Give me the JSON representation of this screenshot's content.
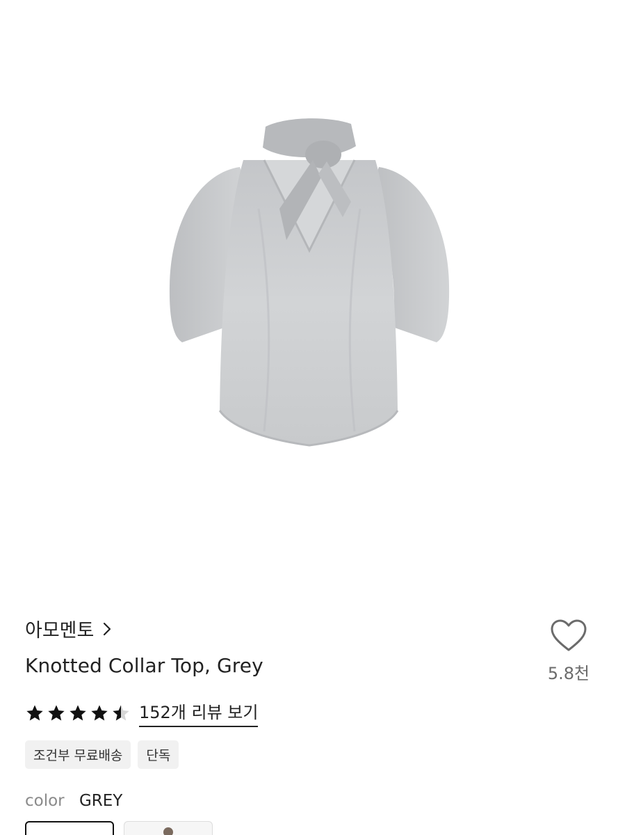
{
  "product": {
    "image_alt": "Knotted Collar Top, Grey",
    "brand": "아모멘토",
    "title": "Knotted Collar Top, Grey",
    "wishlist_count": "5.8천",
    "rating": 4.5,
    "rating_max": 5,
    "review_link": "152개 리뷰 보기",
    "tags": [
      "조건부 무료배송",
      "단독"
    ],
    "color_label": "color",
    "color_value": "GREY"
  },
  "icons": {
    "brand_chevron": "chevron-right-icon",
    "wishlist": "heart-outline-icon",
    "star": "star-icon"
  },
  "colors": {
    "text": "#222222",
    "muted": "#6b6b6b",
    "tag_bg": "#f1f1f1",
    "garment": "#c8cacd"
  }
}
